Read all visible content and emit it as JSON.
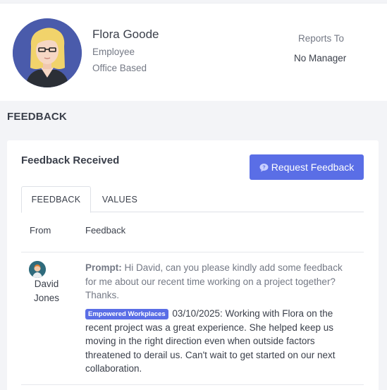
{
  "profile": {
    "name": "Flora Goode",
    "role": "Employee",
    "location": "Office Based",
    "reports_to_label": "Reports To",
    "reports_to_value": "No Manager",
    "avatar_bg": "#4a5bab"
  },
  "section": {
    "title": "FEEDBACK"
  },
  "card": {
    "title": "Feedback Received",
    "request_button": {
      "label": "Request Feedback",
      "icon": "speech-bubble-question-icon",
      "color": "#5a6ee6"
    },
    "tabs": [
      {
        "label": "FEEDBACK",
        "active": true
      },
      {
        "label": "VALUES",
        "active": false
      }
    ],
    "columns": {
      "from": "From",
      "feedback": "Feedback"
    },
    "rows": [
      {
        "from": "David Jones",
        "avatar_icon": "person-avatar-icon",
        "prompt_label": "Prompt:",
        "prompt_text": "Hi David, can you please kindly add some feedback for me about our recent time working on a project together? Thanks.",
        "value_tag": "Empowered Workplaces",
        "feedback_text": "03/10/2025: Working with Flora on the recent project was a great experience. She helped keep us moving in the right direction even when outside factors threatened to derail us. Can't wait to get started on our next collaboration."
      }
    ]
  }
}
